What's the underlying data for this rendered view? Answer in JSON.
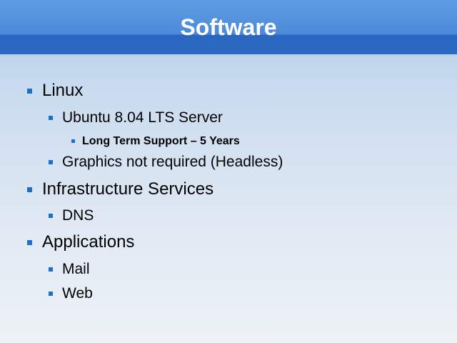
{
  "slide": {
    "title": "Software",
    "bullets": [
      {
        "level": 1,
        "text": "Linux"
      },
      {
        "level": 2,
        "text": "Ubuntu 8.04 LTS Server"
      },
      {
        "level": 3,
        "text": "Long Term Support – 5 Years"
      },
      {
        "level": 2,
        "text": "Graphics not required (Headless)"
      },
      {
        "level": 1,
        "text": "Infrastructure Services"
      },
      {
        "level": 2,
        "text": "DNS"
      },
      {
        "level": 1,
        "text": "Applications"
      },
      {
        "level": 2,
        "text": "Mail"
      },
      {
        "level": 2,
        "text": "Web"
      }
    ]
  },
  "colors": {
    "header": "#4c8ad9",
    "bullet": "#1f6ec9",
    "title_text": "#ffffff"
  }
}
